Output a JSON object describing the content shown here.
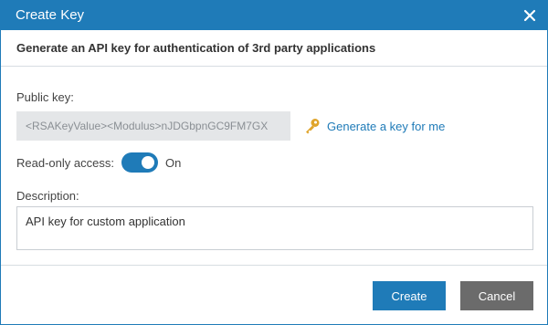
{
  "dialog": {
    "title": "Create Key",
    "subtitle": "Generate an API key for authentication of 3rd party applications"
  },
  "form": {
    "public_key_label": "Public key:",
    "public_key_value": "<RSAKeyValue><Modulus>nJDGbpnGC9FM7GX",
    "generate_link": "Generate a key for me",
    "readonly_label": "Read-only access:",
    "readonly_state": "On",
    "readonly_enabled": true,
    "description_label": "Description:",
    "description_value": "API key for custom application"
  },
  "buttons": {
    "create": "Create",
    "cancel": "Cancel"
  },
  "icons": {
    "close": "close-icon",
    "key": "key-icon"
  },
  "colors": {
    "accent": "#1f7bb8",
    "cancel": "#6b6b6b",
    "key_icon": "#e0a52c",
    "field_bg": "#e4e6e8"
  }
}
